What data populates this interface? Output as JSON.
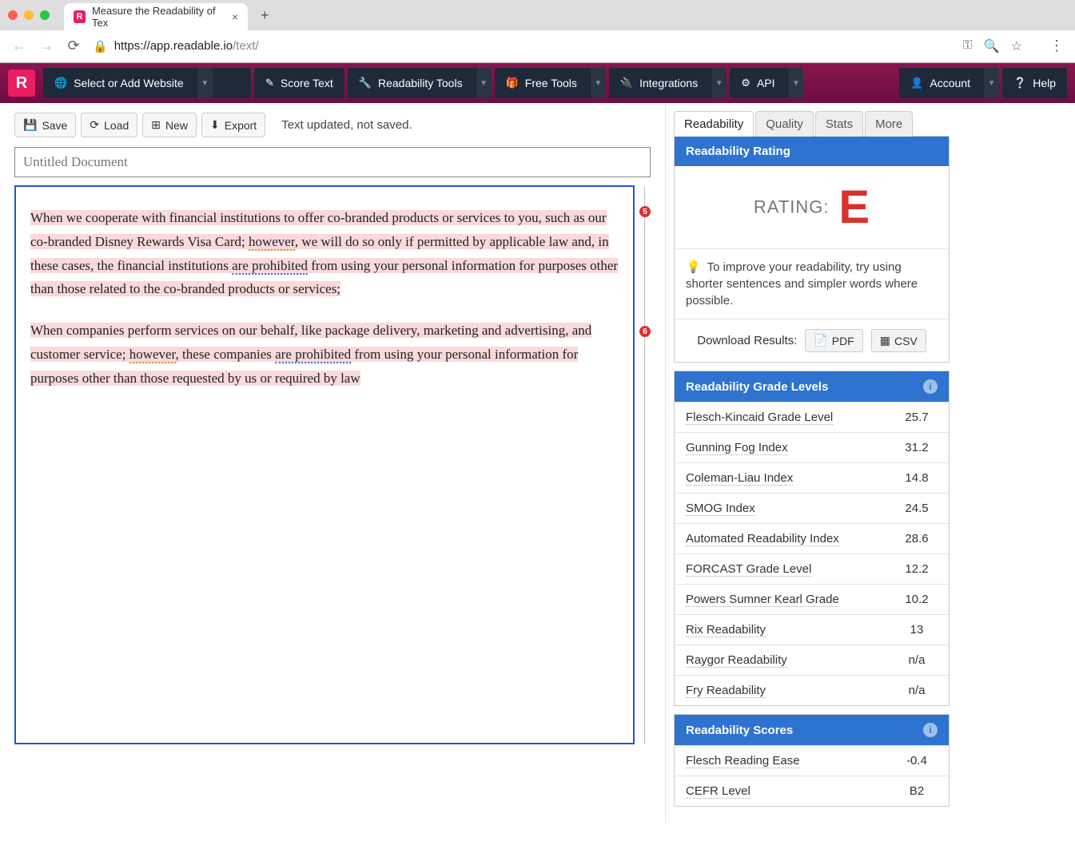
{
  "browser": {
    "tab_title": "Measure the Readability of Tex",
    "url_domain": "https://app.readable.io",
    "url_path": "/text/"
  },
  "nav": {
    "website_label": "Select or Add Website",
    "score_text": "Score Text",
    "readability_tools": "Readability Tools",
    "free_tools": "Free Tools",
    "integrations": "Integrations",
    "api": "API",
    "account": "Account",
    "help": "Help"
  },
  "toolbar": {
    "save": "Save",
    "load": "Load",
    "new": "New",
    "export": "Export",
    "status": "Text updated, not saved."
  },
  "doc": {
    "title_placeholder": "Untitled Document",
    "para1_a": "When we cooperate with financial institutions to offer co-branded products or services to you, such as our co-branded Disney Rewards Visa Card; ",
    "para1_however": "however",
    "para1_b": ", we will do so only if permitted by applicable law and, in these cases, the financial institutions ",
    "para1_prohib": "are prohibited",
    "para1_c": " from using your personal information for purposes other than those related to the co-branded products or services;",
    "para2_a": "When companies perform services on our behalf, like package delivery, marketing and advertising, and customer service; ",
    "para2_however": "however",
    "para2_b": ", these companies ",
    "para2_prohib": "are prohibited",
    "para2_c": " from using your personal information for purposes other than those requested by us or required by law",
    "badge1": "5",
    "badge2": "6"
  },
  "side": {
    "tabs": {
      "readability": "Readability",
      "quality": "Quality",
      "stats": "Stats",
      "more": "More"
    },
    "rating_head": "Readability Rating",
    "rating_label": "RATING:",
    "rating_letter": "E",
    "tip": "To improve your readability, try using shorter sentences and simpler words where possible.",
    "download_label": "Download Results:",
    "pdf": "PDF",
    "csv": "CSV",
    "grade_head": "Readability Grade Levels",
    "grades": [
      {
        "name": "Flesch-Kincaid Grade Level",
        "value": "25.7"
      },
      {
        "name": "Gunning Fog Index",
        "value": "31.2"
      },
      {
        "name": "Coleman-Liau Index",
        "value": "14.8"
      },
      {
        "name": "SMOG Index",
        "value": "24.5"
      },
      {
        "name": "Automated Readability Index",
        "value": "28.6"
      },
      {
        "name": "FORCAST Grade Level",
        "value": "12.2"
      },
      {
        "name": "Powers Sumner Kearl Grade",
        "value": "10.2"
      },
      {
        "name": "Rix Readability",
        "value": "13"
      },
      {
        "name": "Raygor Readability",
        "value": "n/a"
      },
      {
        "name": "Fry Readability",
        "value": "n/a"
      }
    ],
    "scores_head": "Readability Scores",
    "scores": [
      {
        "name": "Flesch Reading Ease",
        "value": "-0.4"
      },
      {
        "name": "CEFR Level",
        "value": "B2"
      }
    ]
  }
}
